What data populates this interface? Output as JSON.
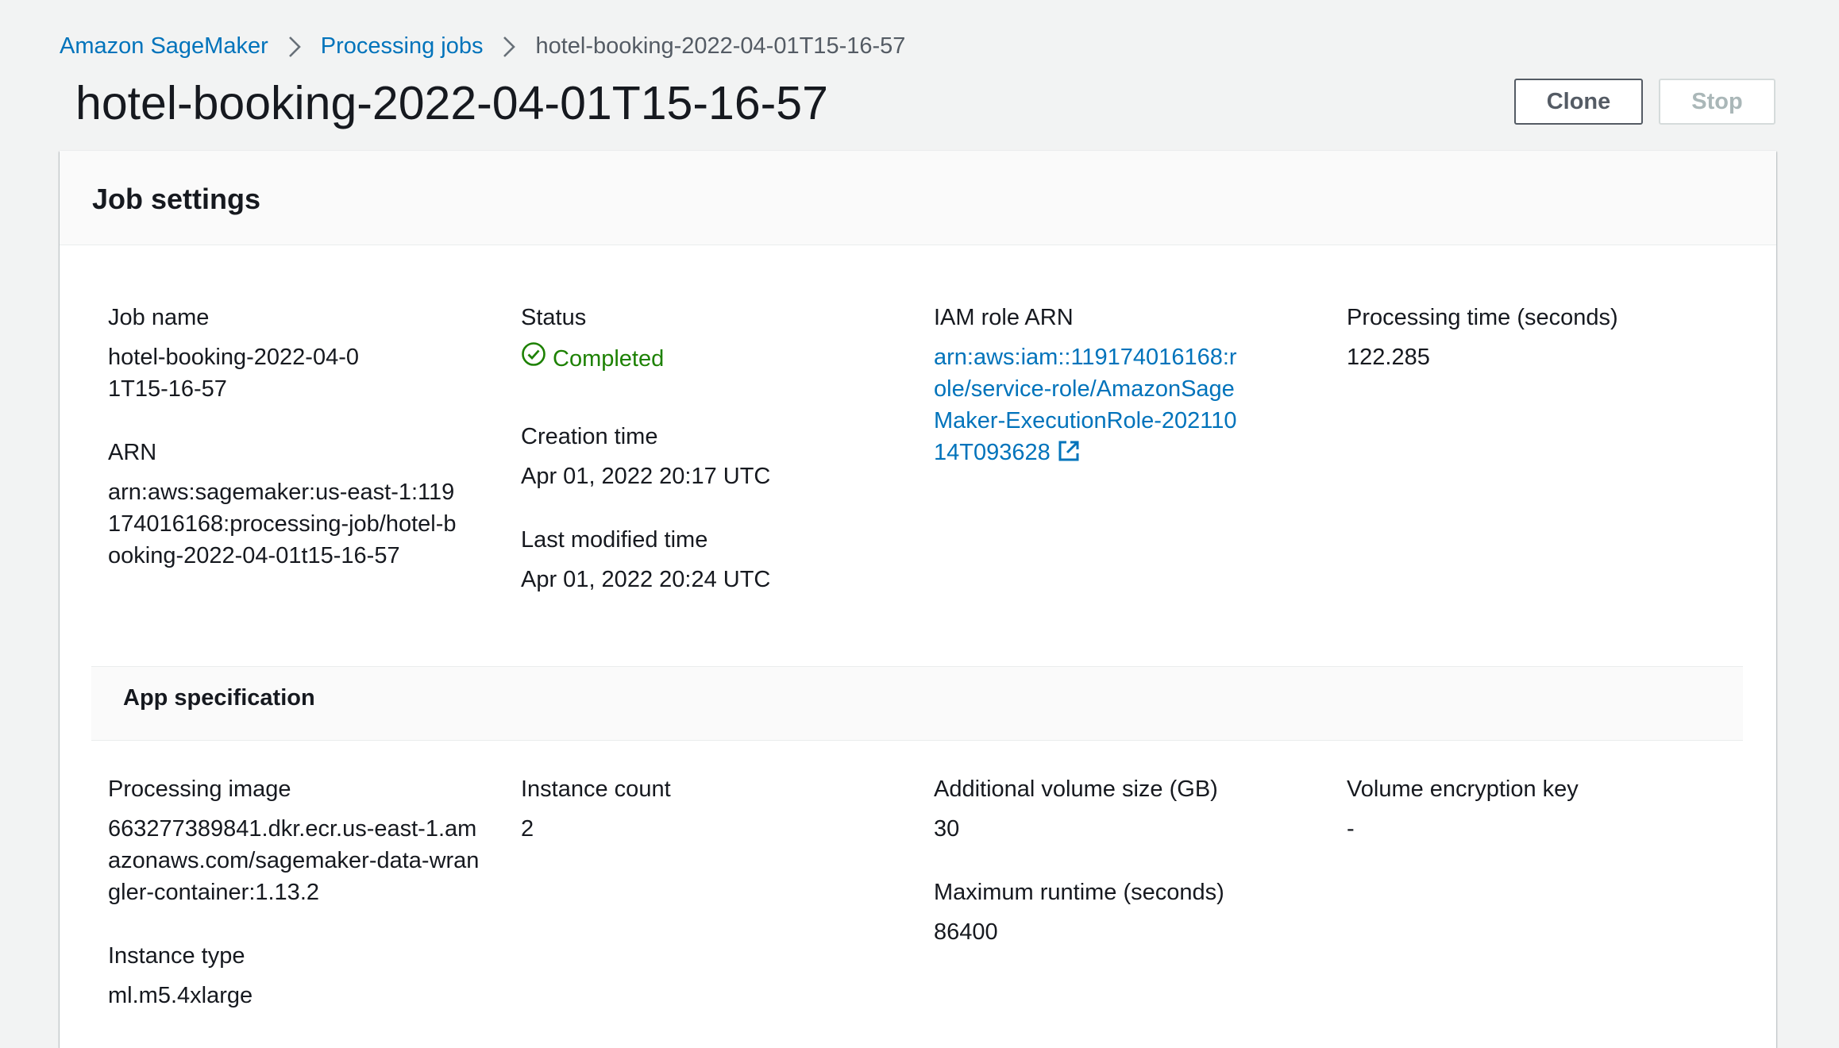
{
  "breadcrumb": {
    "items": [
      "Amazon SageMaker",
      "Processing jobs"
    ],
    "current": "hotel-booking-2022-04-01T15-16-57"
  },
  "page": {
    "title": "hotel-booking-2022-04-01T15-16-57"
  },
  "actions": {
    "clone_label": "Clone",
    "stop_label": "Stop"
  },
  "job_settings": {
    "title": "Job settings",
    "job_name": {
      "label": "Job name",
      "value": "hotel-booking-2022-04-01T15-16-57"
    },
    "arn": {
      "label": "ARN",
      "value": "arn:aws:sagemaker:us-east-1:119174016168:processing-job/hotel-booking-2022-04-01t15-16-57"
    },
    "status": {
      "label": "Status",
      "value": "Completed",
      "color": "#1d8102",
      "icon": "check-circle-icon"
    },
    "creation_time": {
      "label": "Creation time",
      "value": "Apr 01, 2022 20:17 UTC"
    },
    "last_modified_time": {
      "label": "Last modified time",
      "value": "Apr 01, 2022 20:24 UTC"
    },
    "iam_role_arn": {
      "label": "IAM role ARN",
      "value": "arn:aws:iam::119174016168:role/service-role/AmazonSageMaker-ExecutionRole-20211014T093628",
      "icon": "external-link-icon"
    },
    "processing_time": {
      "label": "Processing time (seconds)",
      "value": "122.285"
    }
  },
  "app_specification": {
    "title": "App specification",
    "processing_image": {
      "label": "Processing image",
      "value": "663277389841.dkr.ecr.us-east-1.amazonaws.com/sagemaker-data-wrangler-container:1.13.2"
    },
    "instance_type": {
      "label": "Instance type",
      "value": "ml.m5.4xlarge"
    },
    "instance_count": {
      "label": "Instance count",
      "value": "2"
    },
    "additional_volume_size": {
      "label": "Additional volume size (GB)",
      "value": "30"
    },
    "maximum_runtime": {
      "label": "Maximum runtime (seconds)",
      "value": "86400"
    },
    "volume_encryption_key": {
      "label": "Volume encryption key",
      "value": "-"
    }
  },
  "colors": {
    "link": "#0073bb",
    "success": "#1d8102",
    "background": "#f2f3f3"
  }
}
